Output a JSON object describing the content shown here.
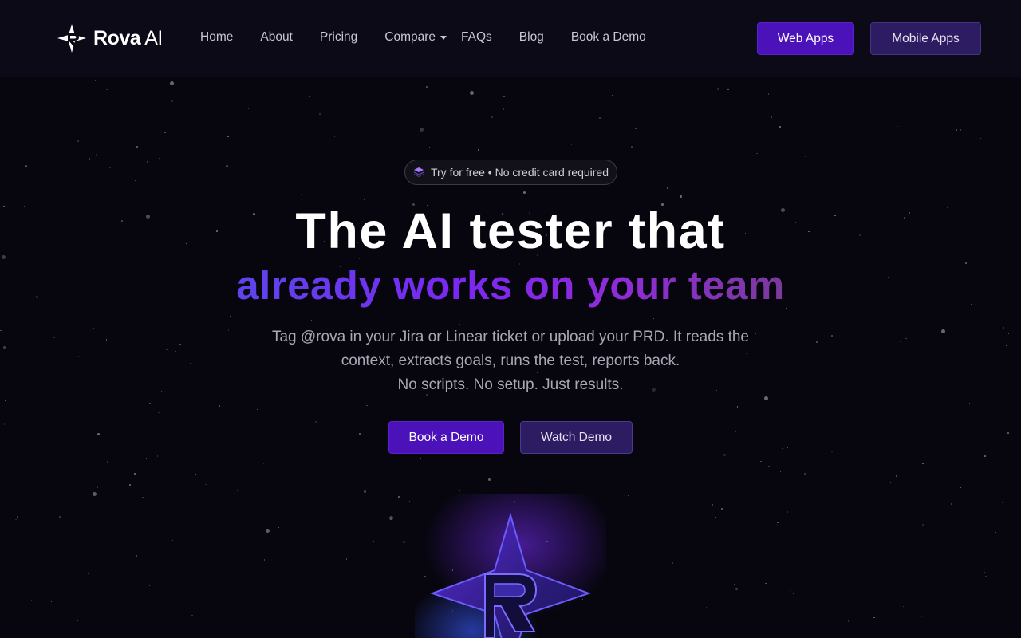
{
  "header": {
    "logo": {
      "bold": "Rova",
      "light": "AI"
    },
    "nav": [
      "Home",
      "About",
      "Pricing",
      "Compare",
      "FAQs",
      "Blog",
      "Book a Demo"
    ],
    "buttons": {
      "web": "Web Apps",
      "mobile": "Mobile Apps"
    }
  },
  "hero": {
    "badge": "Try for free • No credit card required",
    "title_line1": "The AI tester that",
    "title_line2": "already works on your team",
    "subtitle_lines": [
      "Tag @rova in your Jira or Linear ticket or upload your PRD. It reads the",
      "context, extracts goals, runs the test, reports back.",
      "No scripts. No setup. Just results."
    ],
    "cta": {
      "book": "Book a Demo",
      "watch": "Watch Demo"
    }
  },
  "colors": {
    "accent": "#4a12b8",
    "accent_dark": "#2d1c62",
    "background": "#07060f",
    "gradient": [
      "#5d45ea",
      "#7a28f2",
      "#8f2cd8",
      "#7a3a9c"
    ]
  },
  "icons": [
    "rova-logo-icon",
    "chevron-down-icon",
    "layers-icon"
  ]
}
